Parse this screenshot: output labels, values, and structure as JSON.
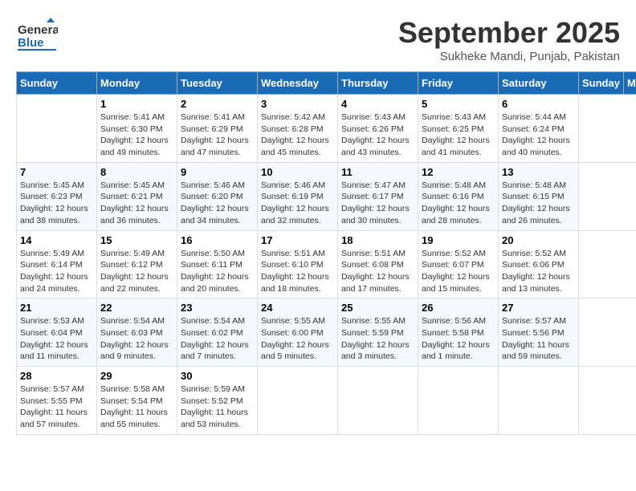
{
  "header": {
    "logo_general": "General",
    "logo_blue": "Blue",
    "month": "September 2025",
    "location": "Sukheke Mandi, Punjab, Pakistan"
  },
  "days_of_week": [
    "Sunday",
    "Monday",
    "Tuesday",
    "Wednesday",
    "Thursday",
    "Friday",
    "Saturday"
  ],
  "weeks": [
    [
      {
        "day": "",
        "info": ""
      },
      {
        "day": "1",
        "info": "Sunrise: 5:41 AM\nSunset: 6:30 PM\nDaylight: 12 hours\nand 49 minutes."
      },
      {
        "day": "2",
        "info": "Sunrise: 5:41 AM\nSunset: 6:29 PM\nDaylight: 12 hours\nand 47 minutes."
      },
      {
        "day": "3",
        "info": "Sunrise: 5:42 AM\nSunset: 6:28 PM\nDaylight: 12 hours\nand 45 minutes."
      },
      {
        "day": "4",
        "info": "Sunrise: 5:43 AM\nSunset: 6:26 PM\nDaylight: 12 hours\nand 43 minutes."
      },
      {
        "day": "5",
        "info": "Sunrise: 5:43 AM\nSunset: 6:25 PM\nDaylight: 12 hours\nand 41 minutes."
      },
      {
        "day": "6",
        "info": "Sunrise: 5:44 AM\nSunset: 6:24 PM\nDaylight: 12 hours\nand 40 minutes."
      }
    ],
    [
      {
        "day": "7",
        "info": "Sunrise: 5:45 AM\nSunset: 6:23 PM\nDaylight: 12 hours\nand 38 minutes."
      },
      {
        "day": "8",
        "info": "Sunrise: 5:45 AM\nSunset: 6:21 PM\nDaylight: 12 hours\nand 36 minutes."
      },
      {
        "day": "9",
        "info": "Sunrise: 5:46 AM\nSunset: 6:20 PM\nDaylight: 12 hours\nand 34 minutes."
      },
      {
        "day": "10",
        "info": "Sunrise: 5:46 AM\nSunset: 6:19 PM\nDaylight: 12 hours\nand 32 minutes."
      },
      {
        "day": "11",
        "info": "Sunrise: 5:47 AM\nSunset: 6:17 PM\nDaylight: 12 hours\nand 30 minutes."
      },
      {
        "day": "12",
        "info": "Sunrise: 5:48 AM\nSunset: 6:16 PM\nDaylight: 12 hours\nand 28 minutes."
      },
      {
        "day": "13",
        "info": "Sunrise: 5:48 AM\nSunset: 6:15 PM\nDaylight: 12 hours\nand 26 minutes."
      }
    ],
    [
      {
        "day": "14",
        "info": "Sunrise: 5:49 AM\nSunset: 6:14 PM\nDaylight: 12 hours\nand 24 minutes."
      },
      {
        "day": "15",
        "info": "Sunrise: 5:49 AM\nSunset: 6:12 PM\nDaylight: 12 hours\nand 22 minutes."
      },
      {
        "day": "16",
        "info": "Sunrise: 5:50 AM\nSunset: 6:11 PM\nDaylight: 12 hours\nand 20 minutes."
      },
      {
        "day": "17",
        "info": "Sunrise: 5:51 AM\nSunset: 6:10 PM\nDaylight: 12 hours\nand 18 minutes."
      },
      {
        "day": "18",
        "info": "Sunrise: 5:51 AM\nSunset: 6:08 PM\nDaylight: 12 hours\nand 17 minutes."
      },
      {
        "day": "19",
        "info": "Sunrise: 5:52 AM\nSunset: 6:07 PM\nDaylight: 12 hours\nand 15 minutes."
      },
      {
        "day": "20",
        "info": "Sunrise: 5:52 AM\nSunset: 6:06 PM\nDaylight: 12 hours\nand 13 minutes."
      }
    ],
    [
      {
        "day": "21",
        "info": "Sunrise: 5:53 AM\nSunset: 6:04 PM\nDaylight: 12 hours\nand 11 minutes."
      },
      {
        "day": "22",
        "info": "Sunrise: 5:54 AM\nSunset: 6:03 PM\nDaylight: 12 hours\nand 9 minutes."
      },
      {
        "day": "23",
        "info": "Sunrise: 5:54 AM\nSunset: 6:02 PM\nDaylight: 12 hours\nand 7 minutes."
      },
      {
        "day": "24",
        "info": "Sunrise: 5:55 AM\nSunset: 6:00 PM\nDaylight: 12 hours\nand 5 minutes."
      },
      {
        "day": "25",
        "info": "Sunrise: 5:55 AM\nSunset: 5:59 PM\nDaylight: 12 hours\nand 3 minutes."
      },
      {
        "day": "26",
        "info": "Sunrise: 5:56 AM\nSunset: 5:58 PM\nDaylight: 12 hours\nand 1 minute."
      },
      {
        "day": "27",
        "info": "Sunrise: 5:57 AM\nSunset: 5:56 PM\nDaylight: 11 hours\nand 59 minutes."
      }
    ],
    [
      {
        "day": "28",
        "info": "Sunrise: 5:57 AM\nSunset: 5:55 PM\nDaylight: 11 hours\nand 57 minutes."
      },
      {
        "day": "29",
        "info": "Sunrise: 5:58 AM\nSunset: 5:54 PM\nDaylight: 11 hours\nand 55 minutes."
      },
      {
        "day": "30",
        "info": "Sunrise: 5:59 AM\nSunset: 5:52 PM\nDaylight: 11 hours\nand 53 minutes."
      },
      {
        "day": "",
        "info": ""
      },
      {
        "day": "",
        "info": ""
      },
      {
        "day": "",
        "info": ""
      },
      {
        "day": "",
        "info": ""
      }
    ]
  ]
}
